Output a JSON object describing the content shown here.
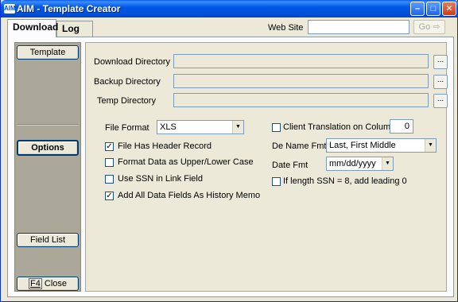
{
  "window": {
    "title": "AIM - Template Creator",
    "icon_label": "AIM",
    "minimize_icon": "minimize-icon",
    "maximize_icon": "maximize-icon",
    "close_icon": "close-icon"
  },
  "tabs": [
    {
      "label": "Download",
      "active": true
    },
    {
      "label": "Log",
      "active": false
    }
  ],
  "website": {
    "label": "Web Site",
    "value": "",
    "go_label": "Go"
  },
  "sidebar": {
    "template_label": "Template",
    "options_label": "Options",
    "field_list_label": "Field List",
    "close_key": "F4",
    "close_label": "Close"
  },
  "directories": {
    "download_label": "Download Directory",
    "download_value": "",
    "backup_label": "Backup Directory",
    "backup_value": "",
    "temp_label": "Temp Directory",
    "temp_value": "",
    "browse_label": "..."
  },
  "options": {
    "file_format_label": "File Format",
    "file_format_value": "XLS",
    "has_header_label": "File Has Header Record",
    "has_header_checked": true,
    "upper_lower_label": "Format Data as Upper/Lower Case",
    "upper_lower_checked": false,
    "ssn_link_label": "Use SSN in Link Field",
    "ssn_link_checked": false,
    "history_memo_label": "Add All Data Fields As History Memo",
    "history_memo_checked": true,
    "client_translation_label": "Client Translation on Column",
    "client_translation_checked": false,
    "client_translation_value": "0",
    "de_name_fmt_label": "De Name Fmt",
    "de_name_fmt_value": "Last, First Middle",
    "date_fmt_label": "Date Fmt",
    "date_fmt_value": "mm/dd/yyyy",
    "ssn_leading_label": "If length SSN = 8, add leading 0",
    "ssn_leading_checked": false
  },
  "colors": {
    "titlebar": "#0058e6",
    "face": "#ece9d8",
    "sidebar": "#aca899"
  }
}
